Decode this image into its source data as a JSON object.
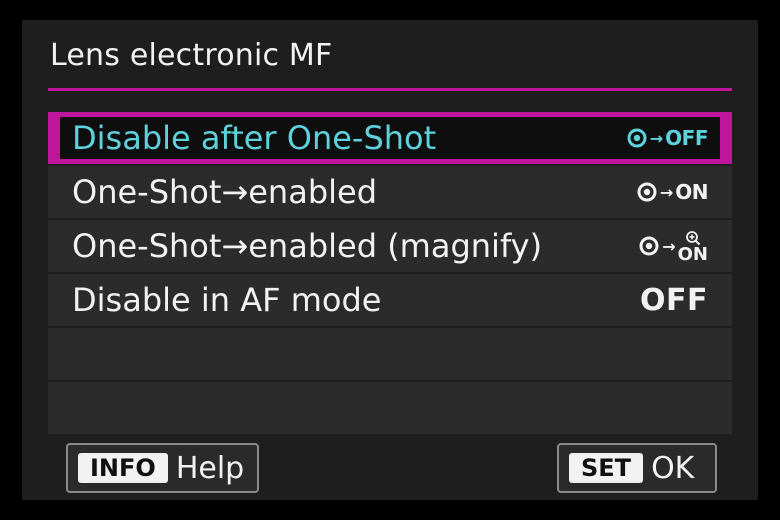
{
  "title": "Lens electronic MF",
  "items": [
    {
      "label": "Disable after One-Shot",
      "value": "OFF",
      "icon": "af-arrow-off-icon",
      "selected": true
    },
    {
      "label": "One-Shot→enabled",
      "value": "ON",
      "icon": "af-arrow-on-icon",
      "selected": false
    },
    {
      "label": "One-Shot→enabled (magnify)",
      "value": "ON",
      "icon": "af-arrow-magnify-on-icon",
      "selected": false
    },
    {
      "label": "Disable in AF mode",
      "value": "OFF",
      "selected": false
    }
  ],
  "footer": {
    "info_key": "INFO",
    "info_label": "Help",
    "set_key": "SET",
    "set_label": "OK"
  },
  "colors": {
    "accent": "#c0169b",
    "selected_text": "#5fd1dc",
    "text": "#f2f2f2",
    "panel": "#1e1e1e"
  }
}
